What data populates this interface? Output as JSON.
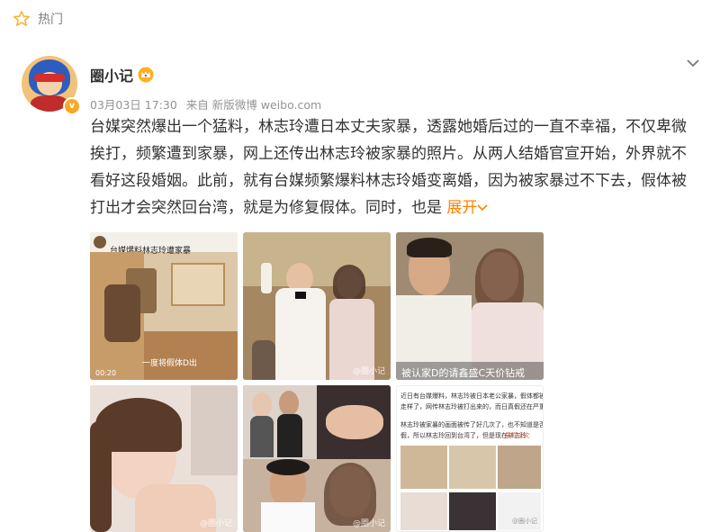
{
  "section": {
    "label": "热门"
  },
  "post": {
    "author": "圈小记",
    "date": "03月03日 17:30",
    "source": "来自 新版微博 weibo.com",
    "text": "台媒突然爆出一个猛料，林志玲遭日本丈夫家暴，透露她婚后过的一直不幸福，不仅卑微挨打，频繁遭到家暴，网上还传出林志玲被家暴的照片。从两人结婚官宣开始，外界就不看好这段婚姻。此前，就有台媒频繁爆料林志玲婚变离婚，因为被家暴过不下去，假体被打出才会突然回台湾，就是为修复假体。同时，也是",
    "expand_label": "展开"
  },
  "images": {
    "img1": {
      "header": "台媒爆料林志玲遭家暴",
      "caption": "一度将假体D出",
      "stamp": "00:20"
    },
    "img3": {
      "caption": "被认家D的请鑫盛C天价钻戒"
    },
    "img6": {
      "line1": "近日有台媒爆料，林志玲被日本老公家暴，假体都被打",
      "line2": "走样了，网传林志玲被打出来的，而日真假还在严重",
      "line3": "林志玲被家暴的画面被传了好几次了，也不知道是否真",
      "line4": "假，所以林志玲回到台湾了，但是现在林志玲",
      "more": "展开全文",
      "watermark": "@圈小记"
    },
    "watermark": "@圈小记"
  },
  "colors": {
    "accent": "#ff8200",
    "meta": "#939393",
    "text": "#333333"
  }
}
